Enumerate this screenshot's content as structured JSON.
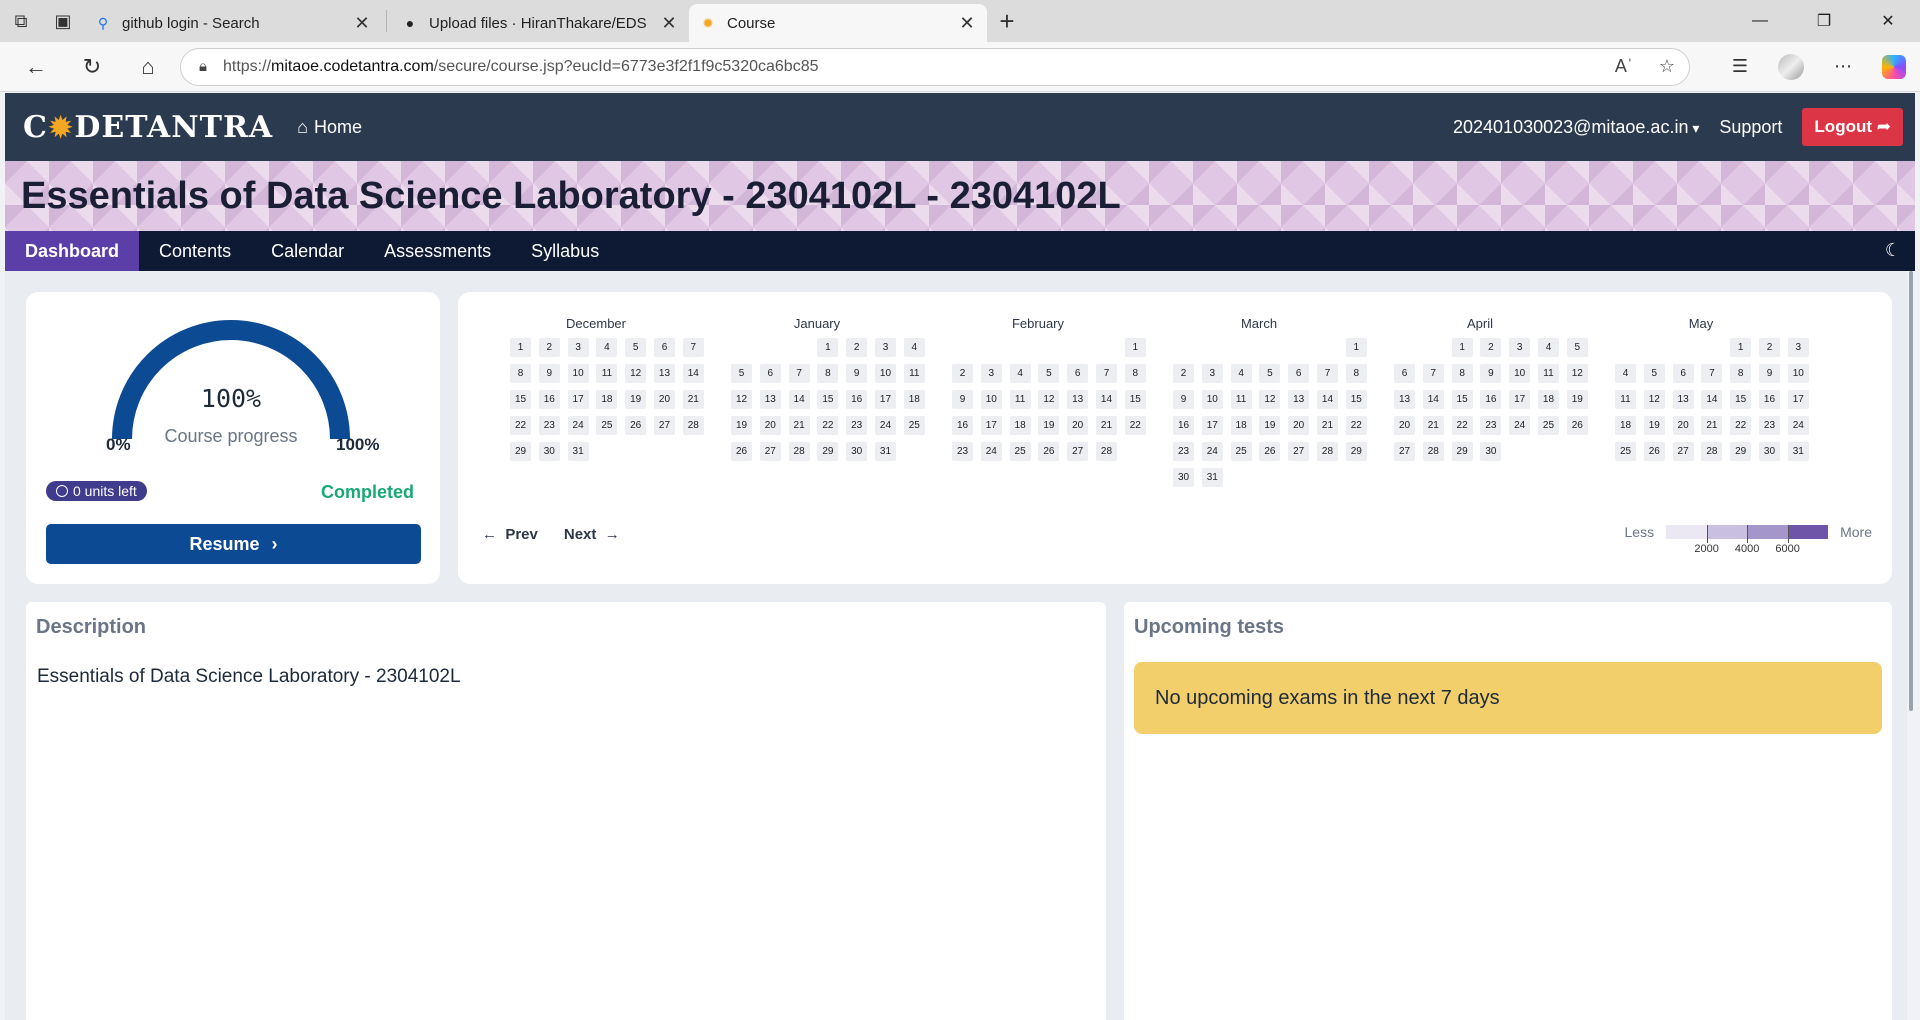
{
  "browser": {
    "tabs": [
      {
        "title": "github login - Search",
        "icon": "search-icon"
      },
      {
        "title": "Upload files · HiranThakare/EDS",
        "icon": "github-icon"
      },
      {
        "title": "Course",
        "icon": "codetantra-sun-icon"
      }
    ],
    "url_prefix": "https://",
    "url_host": "mitaoe.codetantra.com",
    "url_path": "/secure/course.jsp?eucId=6773e3f2f1f9c5320ca6bc85"
  },
  "header": {
    "logo": {
      "pre": "C",
      "post": "DETANTRA"
    },
    "home_label": "Home",
    "user_email": "202401030023@mitaoe.ac.in",
    "support_label": "Support",
    "logout_label": "Logout"
  },
  "banner": {
    "title": "Essentials of Data Science Laboratory - 2304102L - 2304102L"
  },
  "subnav": {
    "items": [
      "Dashboard",
      "Contents",
      "Calendar",
      "Assessments",
      "Syllabus"
    ],
    "active": "Dashboard"
  },
  "progress": {
    "percent_label": "100%",
    "percent_value": 100,
    "label": "Course progress",
    "min_label": "0%",
    "max_label": "100%",
    "units_left": "0 units left",
    "status": "Completed",
    "resume_label": "Resume"
  },
  "calendar": {
    "months": [
      {
        "name": "December",
        "offset": 0,
        "days": 31
      },
      {
        "name": "January",
        "offset": 3,
        "days": 31
      },
      {
        "name": "February",
        "offset": 6,
        "days": 28
      },
      {
        "name": "March",
        "offset": 6,
        "days": 31
      },
      {
        "name": "April",
        "offset": 2,
        "days": 30
      },
      {
        "name": "May",
        "offset": 4,
        "days": 31
      }
    ],
    "prev_label": "Prev",
    "next_label": "Next",
    "legend": {
      "less": "Less",
      "more": "More",
      "ticks": [
        "2000",
        "4000",
        "6000"
      ],
      "colors": [
        "#ebe7f3",
        "#c9bfe0",
        "#a496cb",
        "#6f55a8"
      ]
    }
  },
  "description": {
    "title": "Description",
    "text": "Essentials of Data Science Laboratory - 2304102L"
  },
  "upcoming": {
    "title": "Upcoming tests",
    "message": "No upcoming exams in the next 7 days"
  }
}
